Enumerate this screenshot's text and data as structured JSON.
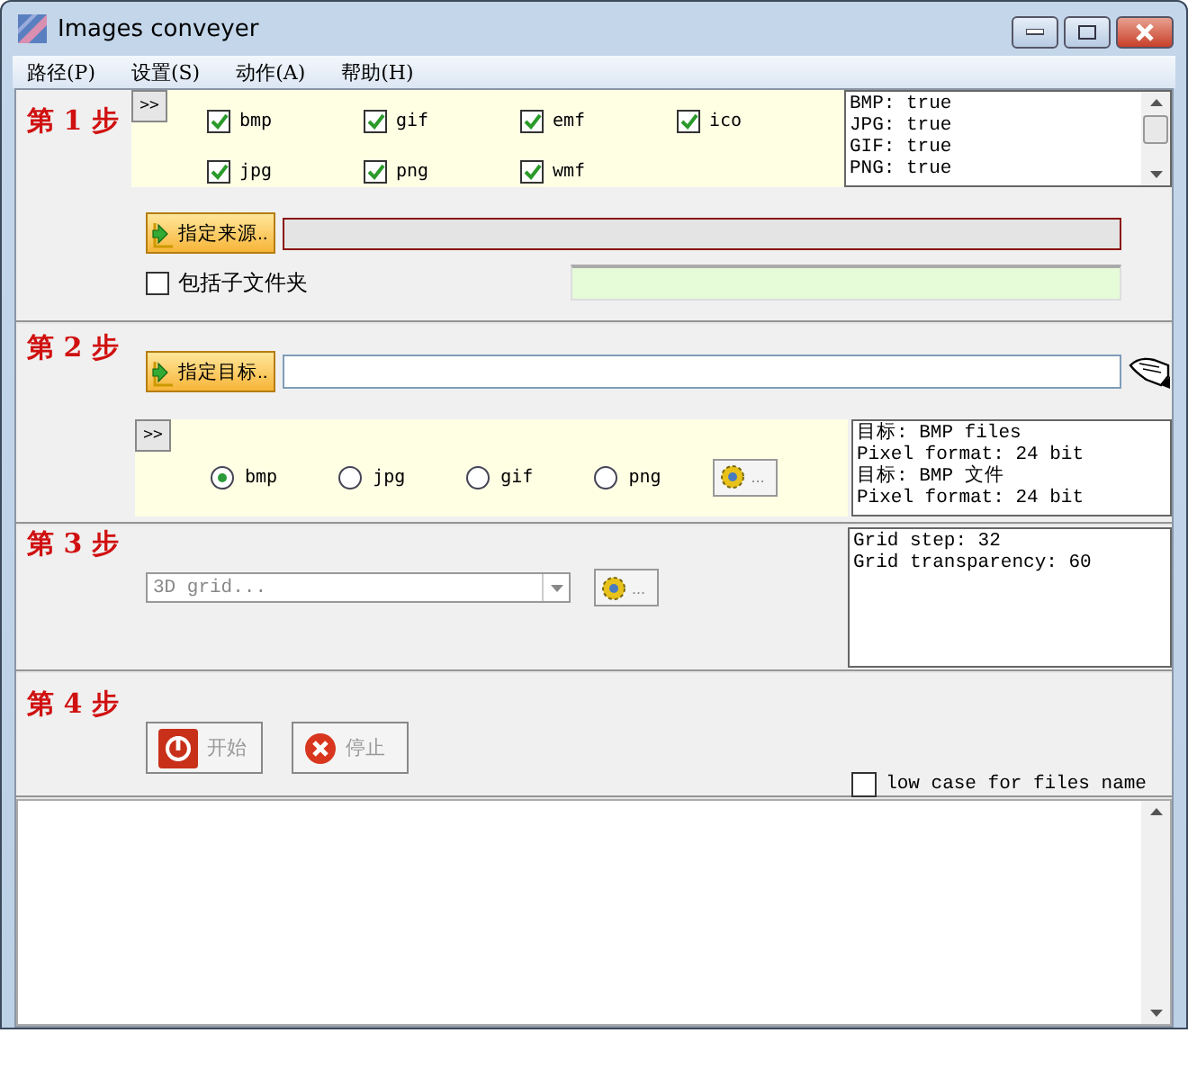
{
  "window": {
    "title": "Images conveyer"
  },
  "menu": [
    {
      "label": "路径(P)"
    },
    {
      "label": "设置(S)"
    },
    {
      "label": "动作(A)"
    },
    {
      "label": "帮助(H)"
    }
  ],
  "step1": {
    "label": "第 1 步",
    "expand_button": ">>",
    "formats": [
      {
        "label": "bmp",
        "checked": true
      },
      {
        "label": "gif",
        "checked": true
      },
      {
        "label": "emf",
        "checked": true
      },
      {
        "label": "ico",
        "checked": true
      },
      {
        "label": "jpg",
        "checked": true
      },
      {
        "label": "png",
        "checked": true
      },
      {
        "label": "wmf",
        "checked": true
      }
    ],
    "info_lines": [
      "BMP: true",
      "JPG: true",
      "GIF: true",
      "PNG: true"
    ],
    "source_button": "指定来源..",
    "include_subfolders": {
      "label": "包括子文件夹",
      "checked": false
    }
  },
  "step2": {
    "label": "第 2 步",
    "target_button": "指定目标..",
    "expand_button": ">>",
    "formats": [
      {
        "label": "bmp",
        "selected": true
      },
      {
        "label": "jpg",
        "selected": false
      },
      {
        "label": "gif",
        "selected": false
      },
      {
        "label": "png",
        "selected": false
      }
    ],
    "options_button": "...",
    "info_lines": [
      "目标: BMP files",
      "Pixel format: 24 bit",
      "目标: BMP 文件",
      "Pixel format: 24 bit"
    ]
  },
  "step3": {
    "label": "第 3 步",
    "effect_select": {
      "value": "3D grid...",
      "disabled": true
    },
    "options_button": "...",
    "info_lines": [
      "Grid step: 32",
      "Grid transparency: 60"
    ]
  },
  "step4": {
    "label": "第 4 步",
    "start_button": {
      "label": "开始",
      "disabled": true
    },
    "stop_button": {
      "label": "停止",
      "disabled": true
    },
    "lowercase_names": {
      "label": "low case for files name",
      "checked": false
    }
  }
}
